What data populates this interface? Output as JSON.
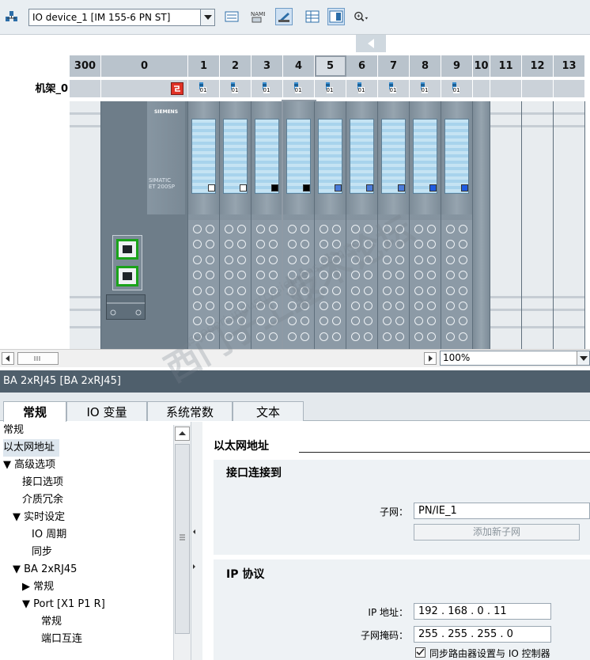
{
  "toolbar": {
    "device_select": "IO device_1 [IM 155-6 PN ST]",
    "icons": [
      "network-icon",
      "dropdown-arrow-icon",
      "show-address-icon",
      "name-icon",
      "show-rack-icon",
      "grid-icon",
      "module-view-icon",
      "zoom-icon"
    ]
  },
  "device_view": {
    "rack_label": "机架_0",
    "slots": [
      "300",
      "0",
      "1",
      "2",
      "3",
      "4",
      "5",
      "6",
      "7",
      "8",
      "9",
      "10",
      "11",
      "12",
      "13"
    ],
    "selected_slot": "5",
    "module_indicator_text": "01",
    "siemens_text": "SIEMENS",
    "simatic_text": "SIMATIC",
    "et_text": "ET 200SP",
    "indicator_colors": {
      "white": "#ffffff",
      "black": "#000000",
      "blue": "#4a7bd9",
      "blue_bright": "#1e5be0"
    }
  },
  "scrollbar": {
    "zoom": "100%"
  },
  "properties": {
    "title": "BA 2xRJ45 [BA 2xRJ45]",
    "tabs": [
      "常规",
      "IO 变量",
      "系统常数",
      "文本"
    ],
    "active_tab": "常规",
    "nav": [
      {
        "label": "常规",
        "level": 0
      },
      {
        "label": "以太网地址",
        "level": 0,
        "selected": true
      },
      {
        "label": "▼ 高级选项",
        "level": 0
      },
      {
        "label": "接口选项",
        "level": 2
      },
      {
        "label": "介质冗余",
        "level": 2
      },
      {
        "label": "▼ 实时设定",
        "level": 1
      },
      {
        "label": "IO 周期",
        "level": 3
      },
      {
        "label": "同步",
        "level": 3
      },
      {
        "label": "▼ BA 2xRJ45",
        "level": 1
      },
      {
        "label": "▶ 常规",
        "level": 2
      },
      {
        "label": "▼ Port [X1 P1 R]",
        "level": 2
      },
      {
        "label": "常规",
        "level": 4
      },
      {
        "label": "端口互连",
        "level": 4
      }
    ],
    "content": {
      "heading": "以太网地址",
      "section1_title": "接口连接到",
      "subnet_label": "子网：",
      "subnet_value": "PN/IE_1",
      "add_subnet_button": "添加新子网",
      "section2_title": "IP 协议",
      "ip_label": "IP 地址：",
      "ip_value": "192 . 168 . 0    . 11",
      "mask_label": "子网掩码：",
      "mask_value": "255 . 255 . 255 . 0",
      "router_checkbox": "同步路由器设置与 IO 控制器"
    }
  },
  "watermark": {
    "line1": "西门子工业",
    "line2": "技术论坛",
    "url": "support.industry.siemens.com/cs"
  }
}
